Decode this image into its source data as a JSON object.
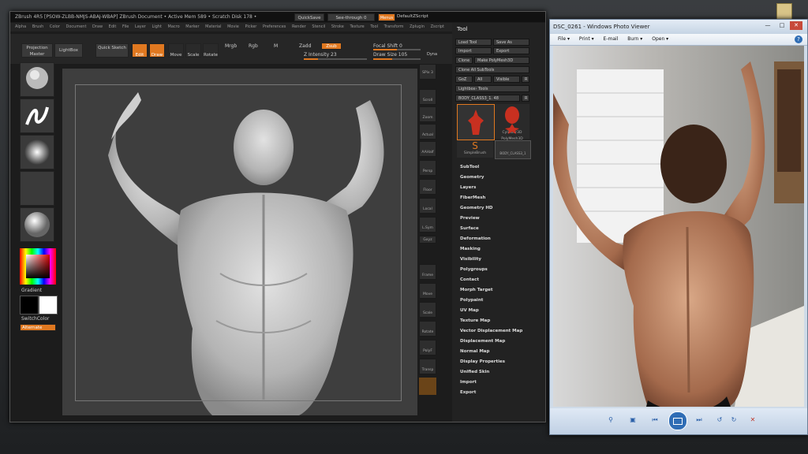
{
  "zbrush": {
    "title": "ZBrush 4R5 [PSOW-ZLBB-NMJS-ABAJ-WBAP]  ZBrush Document   • Active Mem 589 • Scratch Disk 178 •",
    "quicksave": "QuickSave",
    "see_through": "See-through  0",
    "menus_label": "Menus",
    "default_zscript": "DefaultZScript",
    "menu": [
      "Alpha",
      "Brush",
      "Color",
      "Document",
      "Draw",
      "Edit",
      "File",
      "Layer",
      "Light",
      "Macro",
      "Marker",
      "Material",
      "Movie",
      "Picker",
      "Preferences",
      "Render",
      "Stencil",
      "Stroke",
      "Texture",
      "Tool",
      "Transform",
      "Zplugin",
      "Zscript"
    ],
    "toolbar": {
      "projection_master": "Projection Master",
      "lightbox": "LightBox",
      "quick_sketch": "Quick Sketch",
      "edit": "Edit",
      "draw": "Draw",
      "move": "Move",
      "scale": "Scale",
      "rotate": "Rotate",
      "mrgb": "Mrgb",
      "rgb": "Rgb",
      "m": "M",
      "zadd": "Zadd",
      "zsub": "Zsub",
      "z_intensity": "Z Intensity 23",
      "focal_shift": "Focal Shift 0",
      "draw_size": "Draw Size 105",
      "dynamic": "Dyna"
    },
    "left_shelf": {
      "gradient": "Gradient",
      "switch_color": "SwitchColor",
      "alternate": "Alternate"
    },
    "right_shelf": [
      "SPix 3",
      "Scroll",
      "Zoom",
      "Actual",
      "AAHalf",
      "Persp",
      "Floor",
      "Local",
      "L.Sym",
      "Gxyz",
      "Frame",
      "Move",
      "Scale",
      "Rotate",
      "PolyF",
      "Transp"
    ],
    "tool_palette": {
      "title": "Tool",
      "load_tool": "Load Tool",
      "save_as": "Save As",
      "import": "Import",
      "export": "Export",
      "clone": "Clone",
      "make_polymesh": "Make PolyMesh3D",
      "clone_all": "Clone All SubTools",
      "goz": "GoZ",
      "all": "All",
      "visible": "Visible",
      "r": "R",
      "lightbox_tools": "Lightbox› Tools",
      "current_tool": "BODY_CLASS3_1. 48",
      "thumbs": [
        "Cylinder3D",
        "PolyMesh3D",
        "SimpleBrush",
        "BODY_CLASS3_1"
      ],
      "sections": [
        "SubTool",
        "Geometry",
        "Layers",
        "FiberMesh",
        "Geometry HD",
        "Preview",
        "Surface",
        "Deformation",
        "Masking",
        "Visibility",
        "Polygroups",
        "Contact",
        "Morph Target",
        "Polypaint",
        "UV Map",
        "Texture Map",
        "Vector Displacement Map",
        "Displacement Map",
        "Normal Map",
        "Display Properties",
        "Unified Skin",
        "Import",
        "Export"
      ]
    }
  },
  "photo_viewer": {
    "title": "DSC_0261 - Windows Photo Viewer",
    "menu": [
      "File ▾",
      "Print ▾",
      "E-mail",
      "Burn ▾",
      "Open ▾"
    ],
    "help": "?"
  },
  "colors": {
    "accent": "#e07820",
    "zbrush_bg": "#1c1c1c",
    "viewer_chrome": "#cfdbe8"
  }
}
